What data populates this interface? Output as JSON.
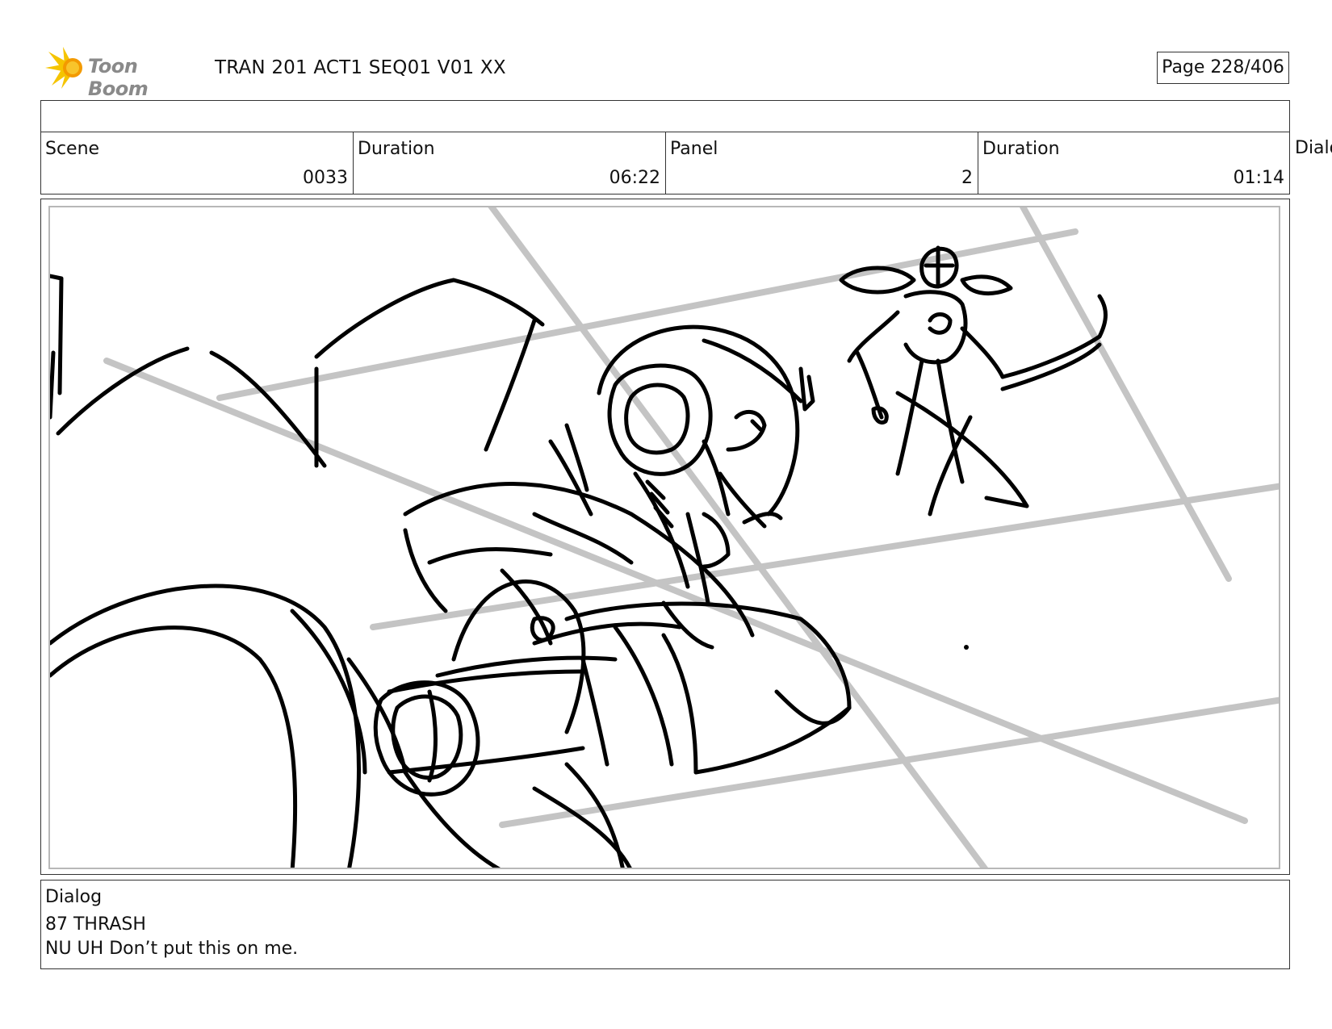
{
  "header": {
    "logo_text": "Toon Boom",
    "logo_icon": "burst-icon",
    "document_title": "TRAN 201 ACT1 SEQ01 V01 XX",
    "page_indicator": "Page 228/406"
  },
  "info_row": [
    {
      "label": "Scene",
      "value": "0033"
    },
    {
      "label": "Duration",
      "value": "06:22"
    },
    {
      "label": "Panel",
      "value": "2"
    },
    {
      "label": "Duration",
      "value": "01:14"
    }
  ],
  "overflow_label": "Dialo",
  "dialog": {
    "label": "Dialog",
    "line1": "87 THRASH",
    "line2": "NU UH Don’t put this on me."
  },
  "colors": {
    "logo_yellow": "#f5c400",
    "logo_orange": "#f39a00",
    "sketch_ink": "#000000",
    "guide_gray": "#c4c4c4",
    "border": "#333333"
  }
}
